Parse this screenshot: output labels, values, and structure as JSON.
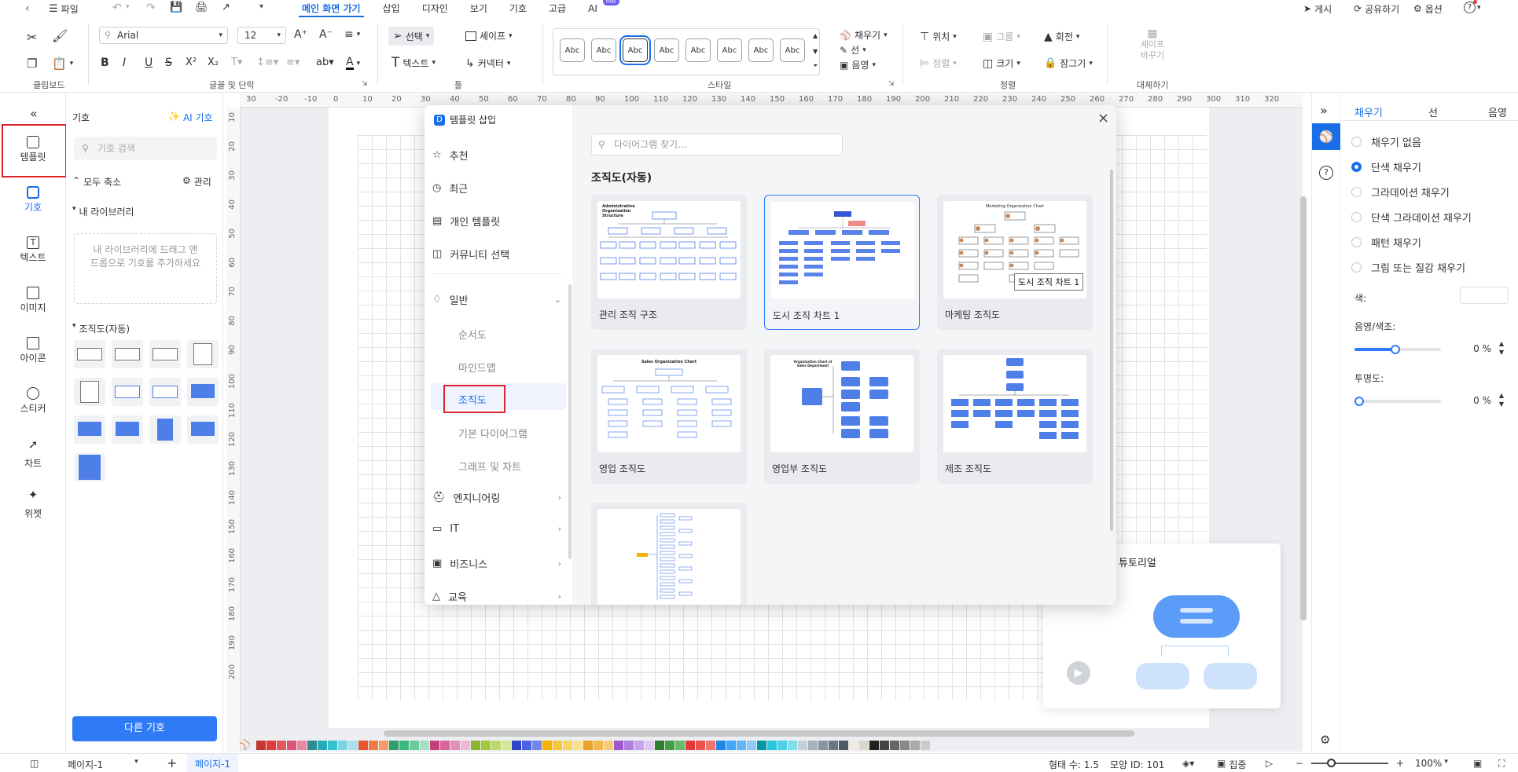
{
  "menubar": {
    "file": "파일",
    "tabs": [
      "메인 화면 가기",
      "삽입",
      "디자인",
      "보기",
      "기호",
      "고급",
      "AI"
    ],
    "hot_badge": "hot",
    "right": [
      "게시",
      "공유하기",
      "옵션"
    ]
  },
  "ribbon": {
    "font_name": "Arial",
    "font_size": "12",
    "select_label": "선택",
    "shape_label": "셰이프",
    "text_label": "텍스트",
    "connector_label": "커넥터",
    "style_abc": [
      "Abc",
      "Abc",
      "Abc",
      "Abc",
      "Abc",
      "Abc",
      "Abc",
      "Abc"
    ],
    "fill_label": "채우기",
    "line_label": "선",
    "shadow_label": "음영",
    "position_label": "위치",
    "group_label": "그룹",
    "rotate_label": "회전",
    "align_label": "정렬",
    "size_label": "크기",
    "lock_label": "잠그기",
    "replace_shape_line1": "셰이프",
    "replace_shape_line2": "바꾸기",
    "groups": [
      "클립보드",
      "글꼴 및 단락",
      "툴",
      "스타일",
      "정렬",
      "대체하기"
    ]
  },
  "leftbar": {
    "items": [
      "템플릿",
      "기호",
      "텍스트",
      "이미지",
      "아이콘",
      "스티커",
      "차트",
      "위젯"
    ]
  },
  "symbols": {
    "title": "기호",
    "ai_label": "AI 기호",
    "search_placeholder": "기호 검색",
    "collapse_all": "모두 축소",
    "manage": "관리",
    "my_library": "내 라이브러리",
    "drop_hint": "내 라이브러리에 드래그 앤 드롭으로 기호를 추가하세요",
    "org_section": "조직도(자동)",
    "more_button": "다른 기호"
  },
  "ruler": {
    "top": [
      "30",
      "-20",
      "-10",
      "0",
      "10",
      "20",
      "30",
      "40",
      "50",
      "60",
      "70",
      "80",
      "90",
      "100",
      "110",
      "120",
      "130",
      "140",
      "150",
      "160",
      "170",
      "180",
      "190",
      "200",
      "210",
      "220",
      "230",
      "240",
      "250",
      "260",
      "270",
      "280",
      "290",
      "300",
      "310",
      "320"
    ],
    "left": [
      "10",
      "20",
      "30",
      "40",
      "50",
      "60",
      "70",
      "80",
      "90",
      "100",
      "110",
      "120",
      "130",
      "140",
      "150",
      "160",
      "170",
      "180",
      "190",
      "200"
    ]
  },
  "dialog": {
    "title": "템플릿 삽입",
    "nav": [
      "추천",
      "최근",
      "개인 템플릿",
      "커뮤니티 선택",
      "일반"
    ],
    "sub": [
      "순서도",
      "마인드맵",
      "조직도",
      "기본 다이어그램",
      "그래프 및 차트"
    ],
    "nav_more": [
      "엔지니어링",
      "IT",
      "비즈니스",
      "교육"
    ],
    "search_placeholder": "다이어그램 찾기...",
    "section": "조직도(자동)",
    "cards": [
      "관리 조직 구조",
      "도시 조직 차트 1",
      "마케팅 조직도",
      "영업 조직도",
      "영업부 조직도",
      "제조 조직도"
    ],
    "thumb_titles": [
      "Administrative Organization Structure",
      "Marketing Organization Chart",
      "Sales Organization Chart",
      "Organization Chart of Sales Department"
    ],
    "tooltip": "도시 조직 차트 1"
  },
  "tutorial": {
    "title": "튜토리얼"
  },
  "rightpanel": {
    "tabs": [
      "채우기",
      "선",
      "음영"
    ],
    "fill_options": [
      "채우기 없음",
      "단색 채우기",
      "그라데이션 채우기",
      "단색 그라데이션 채우기",
      "패턴 채우기",
      "그림 또는 질감 채우기"
    ],
    "color_label": "색:",
    "shade_label": "음영/색조:",
    "shade_value": "0 %",
    "transparency_label": "투명도:",
    "transparency_value": "0 %"
  },
  "statusbar": {
    "page_selector": "페이지-1",
    "page_tab": "페이지-1",
    "shape_count": "형태 수: 1.5",
    "shape_id": "모양 ID: 101",
    "focus": "집중",
    "zoom": "100%"
  },
  "colors": {
    "accent": "#1a6fe8",
    "highlight_box": "#e0242c",
    "swatches": [
      "#c0392b",
      "#e03b3b",
      "#e45858",
      "#d9537a",
      "#e88aa0",
      "#2e8b94",
      "#2aa9b9",
      "#36c1d0",
      "#7fd3de",
      "#a9e2ea",
      "#e8542f",
      "#f07b3f",
      "#f39c6b",
      "#2e9e6a",
      "#3cb77d",
      "#6ccb9c",
      "#a8dfc3",
      "#c3407b",
      "#d8649b",
      "#e58fb8",
      "#f0b9d3",
      "#8bb42e",
      "#a4c93f",
      "#bdd86b",
      "#d6e79a",
      "#3145c9",
      "#4a63e0",
      "#7286ea",
      "#f4b400",
      "#f7c634",
      "#fad462",
      "#fbe08f",
      "#e8a22c",
      "#f0b84e",
      "#f5cb7e",
      "#9b59d0",
      "#b27ee0",
      "#c9a3ea",
      "#e0c8f4",
      "#2e7d32",
      "#43a047",
      "#66bb6a",
      "#e53935",
      "#ef5350",
      "#f07370",
      "#1e88e5",
      "#42a5f5",
      "#64b5f6",
      "#90caf9",
      "#0097a7",
      "#26c6da",
      "#4dd0e1",
      "#80deea",
      "#c6ced8",
      "#a7b1bd",
      "#8995a3",
      "#6b7785",
      "#4f5a67",
      "#f0ebe0",
      "#dcd6c8",
      "#222222",
      "#444444",
      "#666666",
      "#888888",
      "#aaaaaa",
      "#cccccc"
    ]
  }
}
